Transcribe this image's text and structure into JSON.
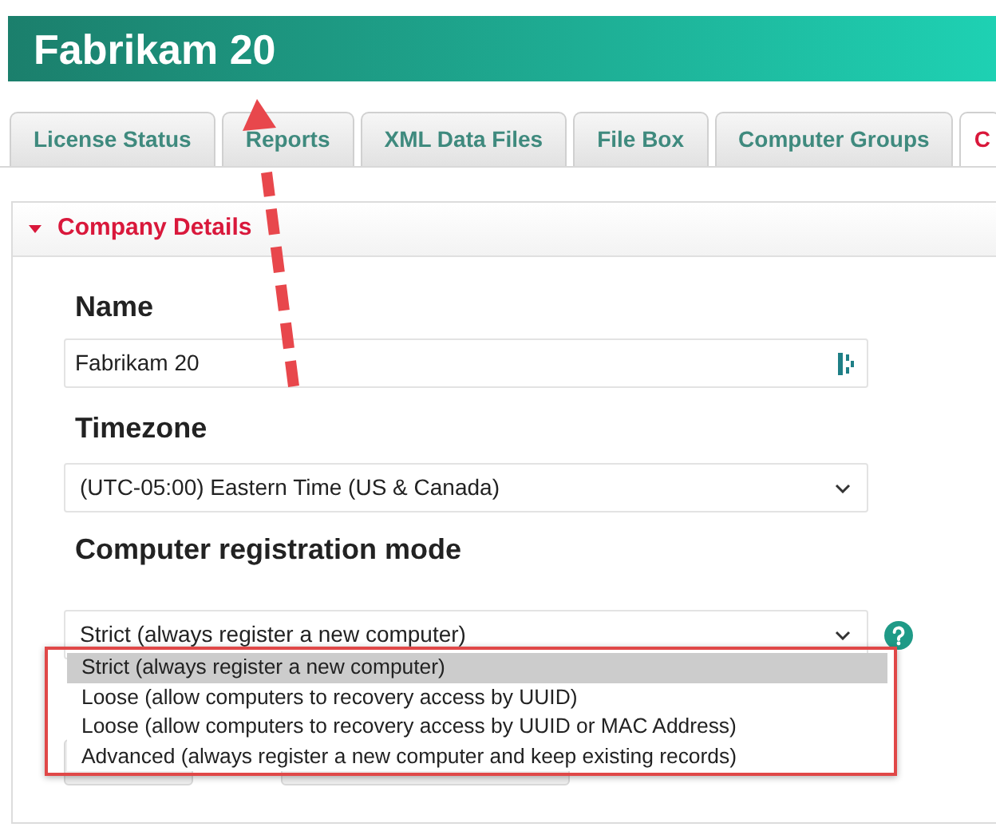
{
  "header": {
    "title": "Fabrikam 20"
  },
  "tabs": [
    {
      "label": "License Status",
      "selected": false
    },
    {
      "label": "Reports",
      "selected": false
    },
    {
      "label": "XML Data Files",
      "selected": false
    },
    {
      "label": "File Box",
      "selected": false
    },
    {
      "label": "Computer Groups",
      "selected": false
    },
    {
      "label": "C",
      "selected": true
    }
  ],
  "section": {
    "title": "Company Details",
    "expanded": true
  },
  "form": {
    "name": {
      "label": "Name",
      "value": "Fabrikam 20"
    },
    "timezone": {
      "label": "Timezone",
      "value": "(UTC-05:00) Eastern Time (US & Canada)"
    },
    "registration_mode": {
      "label": "Computer registration mode",
      "value": "Strict (always register a new computer)",
      "expanded": true,
      "options": [
        {
          "label": "Strict (always register a new computer)",
          "selected": true
        },
        {
          "label": "Loose (allow computers to recovery access by UUID)",
          "selected": false
        },
        {
          "label": "Loose (allow computers to recovery access by UUID or MAC Address)",
          "selected": false
        },
        {
          "label": "Advanced (always register a new computer and keep existing records)",
          "selected": false
        }
      ]
    }
  }
}
